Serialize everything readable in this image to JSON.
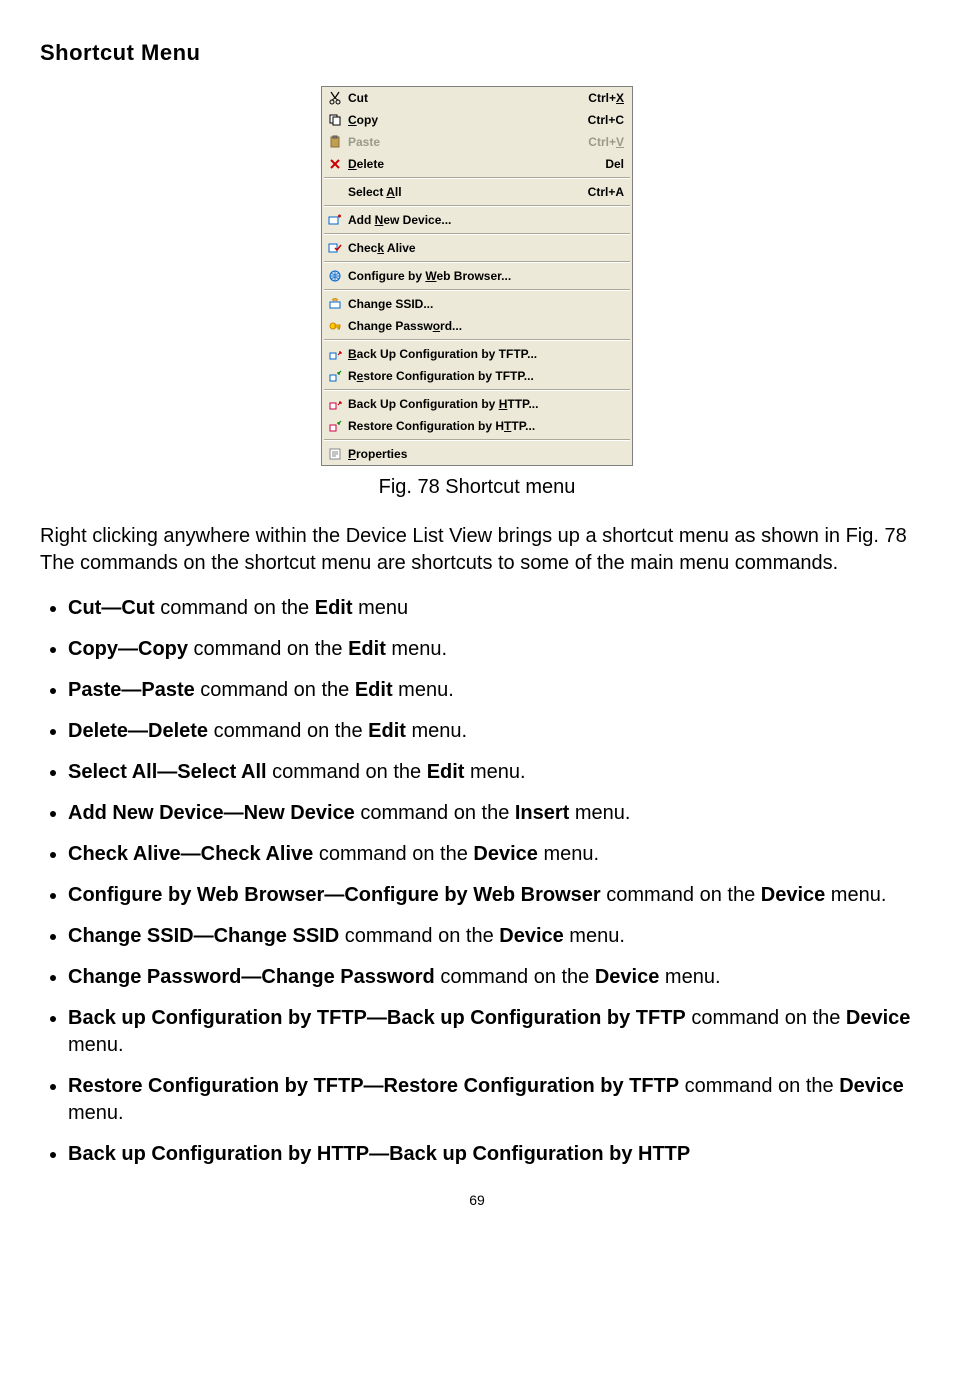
{
  "heading": "Shortcut Menu",
  "menu": {
    "groups": [
      [
        {
          "icon": "cut",
          "label_pre": "",
          "ul": "",
          "label_post": "Cut",
          "shortcut_pre": "Ctrl+",
          "shortcut_ul": "X",
          "shortcut_post": "",
          "disabled": false
        },
        {
          "icon": "copy",
          "label_pre": "",
          "ul": "C",
          "label_post": "opy",
          "shortcut_pre": "Ctrl+C",
          "shortcut_ul": "",
          "shortcut_post": "",
          "disabled": false
        },
        {
          "icon": "paste",
          "label_pre": "",
          "ul": "",
          "label_post": "Paste",
          "shortcut_pre": "Ctrl+",
          "shortcut_ul": "V",
          "shortcut_post": "",
          "disabled": true
        },
        {
          "icon": "delete",
          "label_pre": "",
          "ul": "D",
          "label_post": "elete",
          "shortcut_pre": "Del",
          "shortcut_ul": "",
          "shortcut_post": "",
          "disabled": false
        }
      ],
      [
        {
          "icon": "",
          "label_pre": "Select ",
          "ul": "A",
          "label_post": "ll",
          "shortcut_pre": "Ctrl+A",
          "shortcut_ul": "",
          "shortcut_post": "",
          "disabled": false
        }
      ],
      [
        {
          "icon": "add-device",
          "label_pre": "Add ",
          "ul": "N",
          "label_post": "ew Device...",
          "shortcut_pre": "",
          "shortcut_ul": "",
          "shortcut_post": "",
          "disabled": false
        }
      ],
      [
        {
          "icon": "check-alive",
          "label_pre": "Chec",
          "ul": "k",
          "label_post": " Alive",
          "shortcut_pre": "",
          "shortcut_ul": "",
          "shortcut_post": "",
          "disabled": false
        }
      ],
      [
        {
          "icon": "web",
          "label_pre": "Configure by ",
          "ul": "W",
          "label_post": "eb Browser...",
          "shortcut_pre": "",
          "shortcut_ul": "",
          "shortcut_post": "",
          "disabled": false
        }
      ],
      [
        {
          "icon": "ssid",
          "label_pre": "",
          "ul": "",
          "label_post": "Change SSID...",
          "shortcut_pre": "",
          "shortcut_ul": "",
          "shortcut_post": "",
          "disabled": false
        },
        {
          "icon": "password",
          "label_pre": "Change Passw",
          "ul": "o",
          "label_post": "rd...",
          "shortcut_pre": "",
          "shortcut_ul": "",
          "shortcut_post": "",
          "disabled": false
        }
      ],
      [
        {
          "icon": "backup-tftp",
          "label_pre": "",
          "ul": "B",
          "label_post": "ack Up Configuration by TFTP...",
          "shortcut_pre": "",
          "shortcut_ul": "",
          "shortcut_post": "",
          "disabled": false
        },
        {
          "icon": "restore-tftp",
          "label_pre": "R",
          "ul": "e",
          "label_post": "store Configuration by TFTP...",
          "shortcut_pre": "",
          "shortcut_ul": "",
          "shortcut_post": "",
          "disabled": false
        }
      ],
      [
        {
          "icon": "backup-http",
          "label_pre": "Back Up Configuration by ",
          "ul": "H",
          "label_post": "TTP...",
          "shortcut_pre": "",
          "shortcut_ul": "",
          "shortcut_post": "",
          "disabled": false
        },
        {
          "icon": "restore-http",
          "label_pre": "Restore Configuration by H",
          "ul": "T",
          "label_post": "TP...",
          "shortcut_pre": "",
          "shortcut_ul": "",
          "shortcut_post": "",
          "disabled": false
        }
      ],
      [
        {
          "icon": "properties",
          "label_pre": "",
          "ul": "P",
          "label_post": "roperties",
          "shortcut_pre": "",
          "shortcut_ul": "",
          "shortcut_post": "",
          "disabled": false
        }
      ]
    ]
  },
  "caption": "Fig. 78 Shortcut menu",
  "paragraph": "Right clicking anywhere within the Device List View brings up a shortcut menu as shown in Fig. 78 The commands on the shortcut menu are shortcuts to some of the main menu commands.",
  "bullets": [
    {
      "b1": "Cut—Cut",
      "t1": " command on the ",
      "b2": "Edit",
      "t2": " menu"
    },
    {
      "b1": "Copy—Copy",
      "t1": " command on the ",
      "b2": "Edit",
      "t2": " menu."
    },
    {
      "b1": "Paste—Paste",
      "t1": " command on the ",
      "b2": "Edit",
      "t2": " menu."
    },
    {
      "b1": "Delete—Delete",
      "t1": " command on the ",
      "b2": "Edit",
      "t2": " menu."
    },
    {
      "b1": "Select All—Select All",
      "t1": " command on the ",
      "b2": "Edit",
      "t2": " menu."
    },
    {
      "b1": "Add New Device—New Device",
      "t1": " command on the ",
      "b2": "Insert",
      "t2": " menu."
    },
    {
      "b1": "Check Alive—Check Alive",
      "t1": " command on the ",
      "b2": "Device",
      "t2": " menu."
    },
    {
      "b1": "Configure by Web Browser—Configure by Web Browser",
      "t1": " command on the ",
      "b2": "Device",
      "t2": " menu."
    },
    {
      "b1": "Change SSID—Change SSID",
      "t1": " command on the ",
      "b2": "Device",
      "t2": " menu."
    },
    {
      "b1": "Change Password—Change Password",
      "t1": " command on the ",
      "b2": "Device",
      "t2": " menu."
    },
    {
      "b1": "Back up Configuration by TFTP—Back up Configuration by TFTP",
      "t1": " command on the ",
      "b2": "Device",
      "t2": " menu."
    },
    {
      "b1": "Restore Configuration by TFTP—Restore Configuration by TFTP",
      "t1": " command on the ",
      "b2": "Device",
      "t2": " menu."
    },
    {
      "b1": "Back up Configuration by HTTP—Back up Configuration by HTTP",
      "t1": "",
      "b2": "",
      "t2": ""
    }
  ],
  "page": "69",
  "icons_svg": {
    "cut": "<svg width='14' height='14' viewBox='0 0 14 14'><path d='M3 1 L7 7 M11 1 L7 7' stroke='#000' stroke-width='1.2' fill='none'/><circle cx='4' cy='11' r='2' fill='none' stroke='#000'/><circle cx='10' cy='11' r='2' fill='none' stroke='#000'/><path d='M7 7 L4 9 M7 7 L10 9' stroke='#000'/></svg>",
    "copy": "<svg width='14' height='14' viewBox='0 0 14 14'><rect x='2' y='2' width='7' height='8' fill='#fff' stroke='#000'/><rect x='5' y='4' width='7' height='8' fill='#fff' stroke='#000'/></svg>",
    "paste": "<svg width='14' height='14' viewBox='0 0 14 14'><rect x='3' y='2' width='8' height='10' fill='#c0a050' stroke='#8a6d3b'/><rect x='5' y='1' width='4' height='2' fill='#888' stroke='#555'/></svg>",
    "delete": "<svg width='14' height='14' viewBox='0 0 14 14'><path d='M3 3 L11 11 M11 3 L3 11' stroke='#c00' stroke-width='2'/></svg>",
    "add-device": "<svg width='14' height='14' viewBox='0 0 14 14'><rect x='1' y='4' width='9' height='7' fill='#fff' stroke='#06c'/><path d='M10 3 h3 M11.5 1.5 v3' stroke='#c00' stroke-width='1.5'/></svg>",
    "check-alive": "<svg width='14' height='14' viewBox='0 0 14 14'><rect x='1' y='3' width='8' height='8' fill='#fff' stroke='#06c'/><path d='M7 7 l2 2 l4 -5' stroke='#c00' stroke-width='1.5' fill='none'/></svg>",
    "web": "<svg width='14' height='14' viewBox='0 0 14 14'><circle cx='7' cy='7' r='5' fill='#cde' stroke='#06c'/><path d='M2 7 h10 M7 2 v10 M3 4 q4 3 8 0 M3 10 q4 -3 8 0' stroke='#06c' fill='none' stroke-width='0.7'/></svg>",
    "ssid": "<svg width='14' height='14' viewBox='0 0 14 14'><rect x='2' y='5' width='10' height='6' fill='#fff' stroke='#06c'/><path d='M4 3 q3 -3 6 0' stroke='#c80' fill='none'/><path d='M5 4 q2 -2 4 0' stroke='#c80' fill='none'/></svg>",
    "password": "<svg width='14' height='14' viewBox='0 0 14 14'><circle cx='5' cy='7' r='3' fill='#fc0' stroke='#c80'/><rect x='7' y='6' width='5' height='2' fill='#fc0' stroke='#c80'/><rect x='10' y='8' width='1.5' height='2' fill='#fc0' stroke='#c80'/></svg>",
    "backup-tftp": "<svg width='14' height='14' viewBox='0 0 14 14'><rect x='2' y='6' width='6' height='6' fill='#fff' stroke='#06c'/><path d='M10 8 l3 -3 M13 5 h-2 M13 5 v2' stroke='#c00' stroke-width='1.2' fill='none'/></svg>",
    "restore-tftp": "<svg width='14' height='14' viewBox='0 0 14 14'><rect x='2' y='6' width='6' height='6' fill='#fff' stroke='#06c'/><path d='M13 2 l-3 3 M10 5 h2 M10 5 v-2' stroke='#080' stroke-width='1.2' fill='none'/></svg>",
    "backup-http": "<svg width='14' height='14' viewBox='0 0 14 14'><rect x='2' y='6' width='6' height='6' fill='#fff' stroke='#c04'/><path d='M10 8 l3 -3 M13 5 h-2 M13 5 v2' stroke='#c00' stroke-width='1.2' fill='none'/></svg>",
    "restore-http": "<svg width='14' height='14' viewBox='0 0 14 14'><rect x='2' y='6' width='6' height='6' fill='#fff' stroke='#c04'/><path d='M13 2 l-3 3 M10 5 h2 M10 5 v-2' stroke='#080' stroke-width='1.2' fill='none'/></svg>",
    "properties": "<svg width='14' height='14' viewBox='0 0 14 14'><rect x='2' y='2' width='10' height='10' fill='#fff' stroke='#888'/><path d='M4 5 h6 M4 7 h6 M4 9 h4' stroke='#888'/></svg>"
  }
}
